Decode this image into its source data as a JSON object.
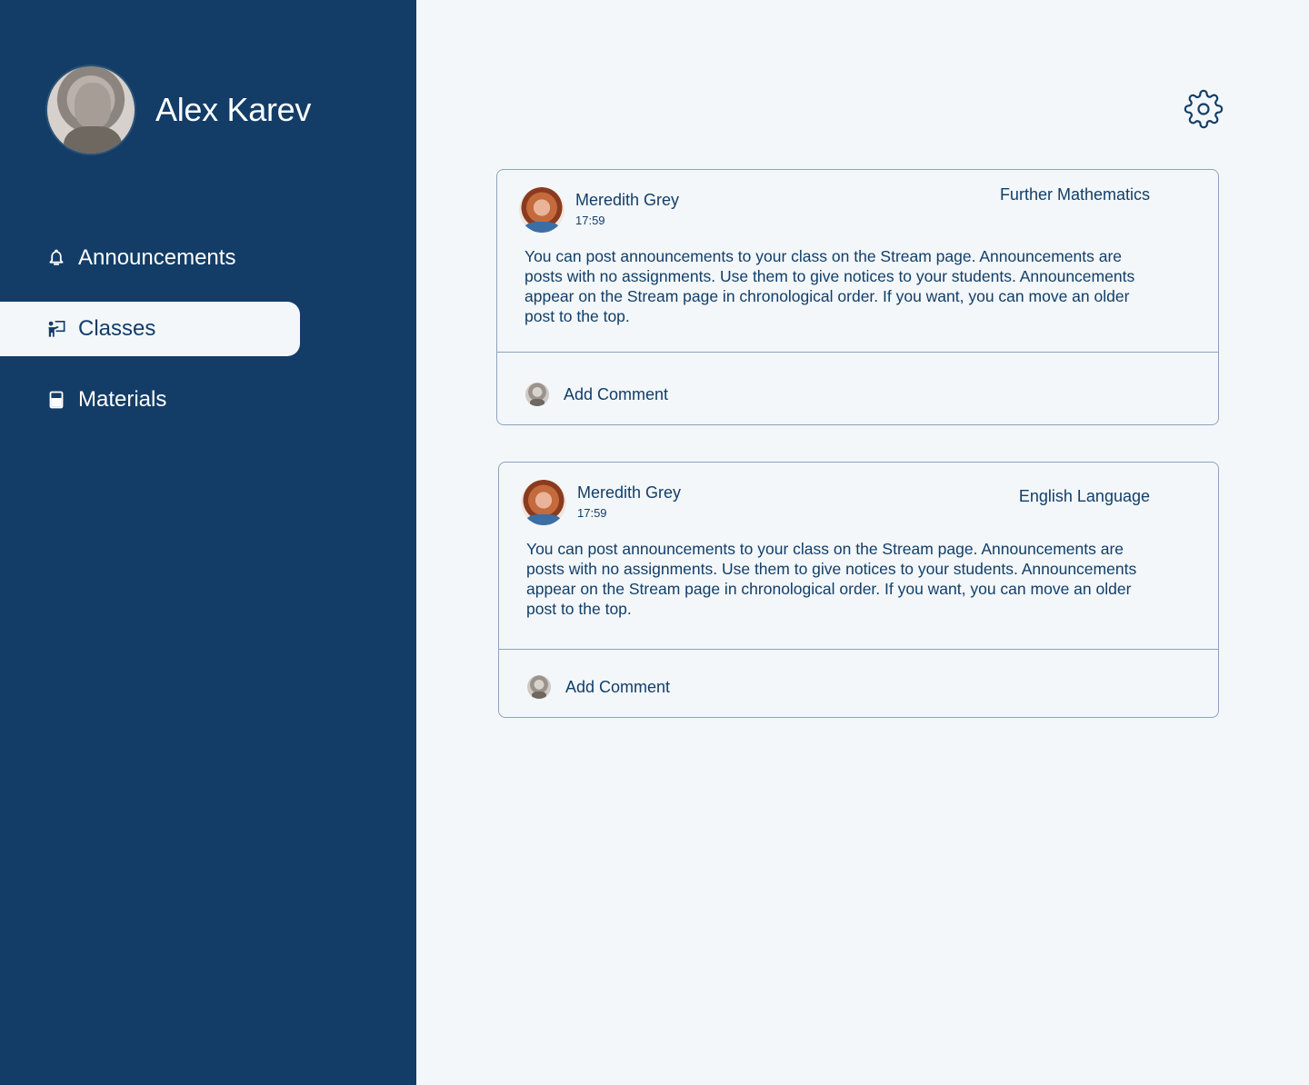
{
  "user": {
    "name": "Alex Karev"
  },
  "nav": {
    "items": [
      {
        "label": "Announcements",
        "icon": "bell-icon",
        "active": false
      },
      {
        "label": "Classes",
        "icon": "teacher-board-icon",
        "active": true
      },
      {
        "label": "Materials",
        "icon": "book-icon",
        "active": false
      }
    ]
  },
  "header": {
    "settings_icon": "gear-icon"
  },
  "posts": [
    {
      "author": "Meredith Grey",
      "time": "17:59",
      "subject": "Further Mathematics",
      "body": "You can post announcements to your class on the Stream page. Announcements are posts with no assignments. Use them to give notices to your students. Announcements appear on the Stream page in chronological order. If you want, you can move an older post to the top.",
      "comment_label": "Add Comment"
    },
    {
      "author": "Meredith Grey",
      "time": "17:59",
      "subject": "English Language",
      "body": "You can post announcements to your class on the Stream page. Announcements are posts with no assignments. Use them to give notices to your students. Announcements appear on the Stream page in chronological order. If you want, you can move an older post to the top.",
      "comment_label": "Add Comment"
    }
  ],
  "colors": {
    "sidebar": "#133d67",
    "background": "#f3f7fa",
    "text": "#123e68",
    "border": "#8ea4bd"
  }
}
